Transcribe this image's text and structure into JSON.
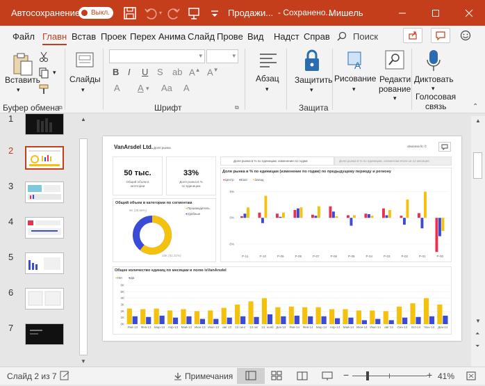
{
  "titlebar": {
    "autosave_label": "Автосохранение",
    "autosave_state": "Выкл.",
    "document": "Продажи...",
    "saved_status": "Сохранено...",
    "user": "Мишель"
  },
  "tabs": [
    "Файл",
    "Главн",
    "Встав",
    "Проек",
    "Перех",
    "Анима",
    "Слайд",
    "Прове",
    "Вид",
    "Надст",
    "Справ"
  ],
  "search_label": "Поиск",
  "ribbon": {
    "paste": "Вставить",
    "slides": "Слайды",
    "paragraph": "Абзац",
    "protect": "Защитить",
    "drawing": "Рисование",
    "editing_1": "Редакти",
    "editing_2": "рование",
    "dictate": "Диктовать",
    "groups": {
      "clipboard": "Буфер обмена",
      "font": "Шрифт",
      "protection": "Защита",
      "voice_1": "Голосовая",
      "voice_2": "связь"
    }
  },
  "slides": [
    {
      "num": "1"
    },
    {
      "num": "2"
    },
    {
      "num": "3"
    },
    {
      "num": "4"
    },
    {
      "num": "5"
    },
    {
      "num": "6"
    },
    {
      "num": "7"
    }
  ],
  "dashboard": {
    "brand": "VanArsdel Ltd.",
    "subtitle": "Доля рынка",
    "corner": "obviense llc ©",
    "kpi1_value": "50 тыс.",
    "kpi1_label_1": "Общий объем в",
    "kpi1_label_2": "категории",
    "kpi2_value": "33%",
    "kpi2_label_1": "Доля рынка в %",
    "kpi2_label_2": "по единицам",
    "tab1": "Доля рынка в % по единицам, изменение по годам",
    "tab2": "Доля рынка в % по единицам, сегментам итоги за 12 месяцев",
    "donut_title": "Общий объем в категории по сегментам",
    "donut_legend": [
      "Производитель",
      "Удобные"
    ],
    "donut_values": [
      {
        "label": "9K (39.69%)",
        "value": 39.69
      },
      {
        "label": "15K (61.31%)",
        "value": 61.31
      }
    ],
    "bar_title": "Доля рынка в % по единицам (изменение по годам) по предыдущему периоду и региону",
    "bar_legend": [
      "Центр",
      "East",
      "Запад"
    ],
    "bottom_title": "Общее количество единиц по месяцам и полю isVanArsdel",
    "bottom_legend": [
      "Нет",
      "Да"
    ]
  },
  "chart_data": [
    {
      "type": "bar",
      "title": "Доля рынка в % по единицам (изменение по годам) по предыдущему периоду и региону",
      "categories": [
        "P-11",
        "P-10",
        "P-09",
        "P-08",
        "P-07",
        "P-06",
        "P-05",
        "P-04",
        "P-03",
        "P-02",
        "P-01",
        "P-00"
      ],
      "yticks": [
        "5%",
        "0%",
        "-5%"
      ],
      "ylim": [
        -7,
        6
      ],
      "series": [
        {
          "name": "Центр",
          "color": "#e8304f",
          "values": [
            0.3,
            1.0,
            0.8,
            1.5,
            0.6,
            2.2,
            0.5,
            0.8,
            1.8,
            0.4,
            0.9,
            -6.5
          ]
        },
        {
          "name": "East",
          "color": "#3a4bd8",
          "values": [
            0.8,
            -1.0,
            0.2,
            1.8,
            0.4,
            1.2,
            -1.5,
            0.7,
            0.5,
            -1.3,
            -2.0,
            -3.5
          ]
        },
        {
          "name": "Запад",
          "color": "#f4c20d",
          "values": [
            2.0,
            4.2,
            1.0,
            2.0,
            2.2,
            0.3,
            0.5,
            0.4,
            1.5,
            3.5,
            5.0,
            -2.5
          ]
        }
      ]
    },
    {
      "type": "bar",
      "title": "Общее количество единиц по месяцам и полю isVanArsdel",
      "categories": [
        "Янв-13",
        "Фев-13",
        "Мар-13",
        "Апр-13",
        "Май-13",
        "Июн-13",
        "Июл-13",
        "авг 13",
        "13 сент",
        "13 окт",
        "13, нояб",
        "Дек-13",
        "Янв-14",
        "Фев-14",
        "Мар-14",
        "Апр-14",
        "Май-14",
        "Июн-14",
        "Июл-14",
        "авг 14",
        "Сен-14",
        "Oct-14",
        "Nov-14",
        "Дек-14"
      ],
      "yticks": [
        "6K",
        "5K",
        "4K",
        "3K",
        "2K",
        "1K",
        "0K"
      ],
      "ylim": [
        0,
        6
      ],
      "series": [
        {
          "name": "Нет",
          "color": "#f4c20d",
          "values": [
            2.4,
            2.3,
            2.4,
            2.1,
            2.3,
            2.0,
            2.1,
            2.5,
            3.0,
            3.5,
            4.0,
            2.6,
            2.7,
            2.6,
            2.6,
            2.3,
            2.3,
            2.1,
            2.1,
            2.0,
            2.7,
            3.2,
            4.0,
            3.0
          ]
        },
        {
          "name": "Да",
          "color": "#3a4bd8",
          "values": [
            1.2,
            1.1,
            1.3,
            1.0,
            1.2,
            0.8,
            0.8,
            1.0,
            1.2,
            1.1,
            1.5,
            1.2,
            1.3,
            1.2,
            1.2,
            0.9,
            1.0,
            0.6,
            0.8,
            0.6,
            1.0,
            1.1,
            1.2,
            1.3
          ]
        }
      ]
    }
  ],
  "status": {
    "slide_info": "Слайд 2 из 7",
    "notes": "Примечания",
    "zoom": "41%"
  }
}
